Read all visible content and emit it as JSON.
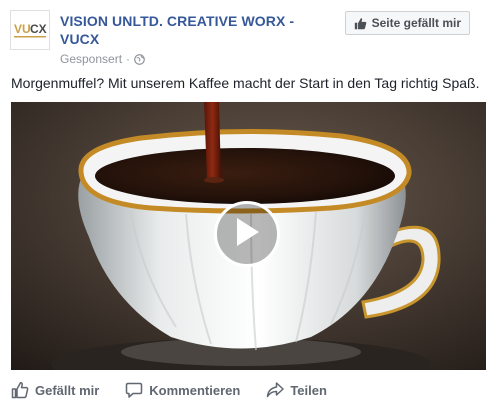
{
  "header": {
    "page_name": "VISION UNLTD. CREATIVE WORX - VUCX",
    "sponsored": "Gesponsert",
    "separator": "·",
    "privacy_icon": "globe-icon",
    "logo_icon": "vucx-logo",
    "like_page_label": "Seite gefällt mir",
    "like_page_icon": "thumbs-up-icon"
  },
  "post": {
    "message": "Morgenmuffel? Mit unserem Kaffee macht der Start in den Tag richtig Spaß."
  },
  "video": {
    "play_icon": "play-icon"
  },
  "actions": {
    "like_label": "Gefällt mir",
    "comment_label": "Kommentieren",
    "share_label": "Teilen"
  },
  "colors": {
    "page_name": "#365899",
    "action_text": "#606770",
    "meta_text": "#90949c"
  }
}
